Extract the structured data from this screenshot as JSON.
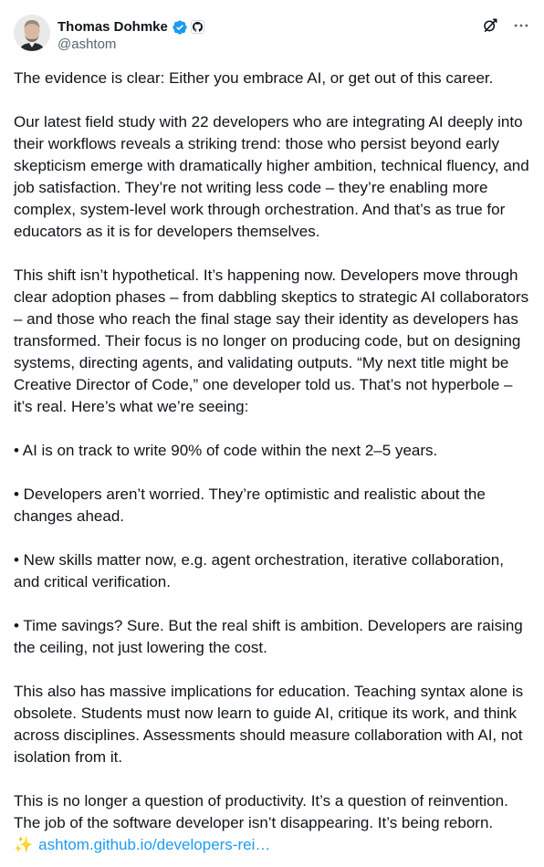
{
  "author": {
    "display_name": "Thomas Dohmke",
    "handle": "@ashtom",
    "verified": true,
    "affiliate_badge": "github-icon"
  },
  "actions": {
    "grok_icon": "grok-icon",
    "more_icon": "more-icon"
  },
  "colors": {
    "text": "#0f1419",
    "secondary": "#536471",
    "link": "#1d9bf0",
    "verified": "#1d9bf0"
  },
  "tweet": {
    "p1": "The evidence is clear: Either you embrace AI, or get out of this career.",
    "p2": "Our latest field study with 22 developers who are integrating AI deeply into their workflows reveals a striking trend: those who persist beyond early skepticism emerge with dramatically higher ambition, technical fluency, and job satisfaction. They’re not writing less code – they’re enabling more complex, system-level work through orchestration. And that’s as true for educators as it is for developers themselves.",
    "p3": "This shift isn’t hypothetical. It’s happening now. Developers move through clear adoption phases – from dabbling skeptics to strategic AI collaborators – and those who reach the final stage say their identity as developers has transformed. Their focus is no longer on producing code, but on designing systems, directing agents, and validating outputs. “My next title might be Creative Director of Code,” one developer told us. That’s not hyperbole – it’s real. Here’s what we’re seeing:",
    "bullets": [
      " • AI is on track to write 90% of code within the next 2–5 years.",
      " • Developers aren’t worried. They’re optimistic and realistic about the changes ahead.",
      " • New skills matter now, e.g. agent orchestration, iterative collaboration, and critical verification.",
      " • Time savings? Sure. But the real shift is ambition. Developers are raising the ceiling, not just lowering the cost."
    ],
    "p4": "This also has massive implications for education. Teaching syntax alone is obsolete. Students must now learn to guide AI, critique its work, and think across disciplines. Assessments should measure collaboration with AI, not isolation from it.",
    "p5": "This is no longer a question of productivity. It’s a question of reinvention. The job of the software developer isn’t disappearing. It’s being reborn.",
    "sparkle": "✨",
    "link_text": "ashtom.github.io/developers-rei…"
  }
}
